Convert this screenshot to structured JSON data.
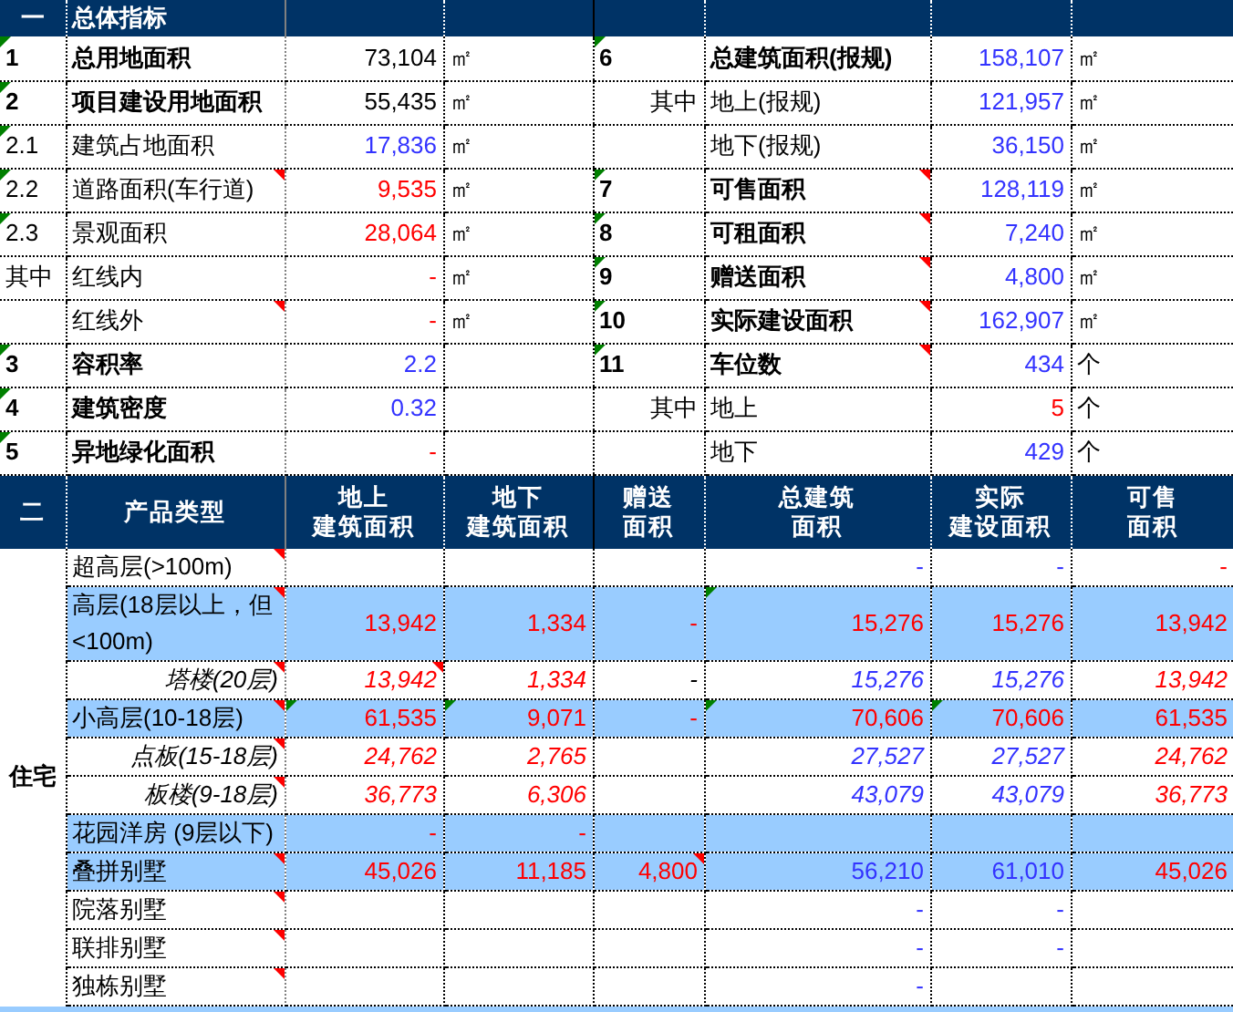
{
  "summary": {
    "section_no": "一",
    "title": "总体指标",
    "rows": [
      {
        "left": {
          "no": "1",
          "flagged": true,
          "label": "总用地面积",
          "bold": true,
          "value": "73,104",
          "color": "#000000",
          "unit": "㎡"
        },
        "right": {
          "no": "6",
          "flagged": true,
          "label": "总建筑面积(报规)",
          "bold": true,
          "value": "158,107",
          "color": "#3333ff",
          "unit": "㎡"
        }
      },
      {
        "left": {
          "no": "2",
          "flagged": true,
          "label": "项目建设用地面积",
          "bold": true,
          "value": "55,435",
          "color": "#000000",
          "unit": "㎡"
        },
        "right": {
          "no": "其中",
          "label": "地上(报规)",
          "value": "121,957",
          "color": "#3333ff",
          "unit": "㎡"
        }
      },
      {
        "left": {
          "no": "2.1",
          "flagged": true,
          "label": "建筑占地面积",
          "value": "17,836",
          "color": "#3333ff",
          "unit": "㎡"
        },
        "right": {
          "label": "地下(报规)",
          "value": "36,150",
          "color": "#3333ff",
          "unit": "㎡"
        }
      },
      {
        "left": {
          "no": "2.2",
          "flagged": true,
          "label": "道路面积(车行道)",
          "comment": true,
          "value": "9,535",
          "color": "#ff0000",
          "unit": "㎡"
        },
        "right": {
          "no": "7",
          "flagged": true,
          "label": "可售面积",
          "bold": true,
          "comment": true,
          "value": "128,119",
          "color": "#3333ff",
          "unit": "㎡"
        }
      },
      {
        "left": {
          "no": "2.3",
          "flagged": true,
          "label": "景观面积",
          "value": "28,064",
          "color": "#ff0000",
          "unit": "㎡"
        },
        "right": {
          "no": "8",
          "flagged": true,
          "label": "可租面积",
          "bold": true,
          "comment": true,
          "value": "7,240",
          "color": "#3333ff",
          "unit": "㎡"
        }
      },
      {
        "left": {
          "no": "其中",
          "label": "红线内",
          "value": "-",
          "color": "#ff0000",
          "unit": "㎡"
        },
        "right": {
          "no": "9",
          "flagged": true,
          "label": "赠送面积",
          "bold": true,
          "comment": true,
          "value": "4,800",
          "color": "#3333ff",
          "unit": "㎡"
        }
      },
      {
        "left": {
          "label": "红线外",
          "comment": true,
          "value": "-",
          "color": "#ff0000",
          "unit": "㎡"
        },
        "right": {
          "no": "10",
          "flagged": true,
          "label": "实际建设面积",
          "bold": true,
          "comment": true,
          "value": "162,907",
          "color": "#3333ff",
          "unit": "㎡"
        }
      },
      {
        "left": {
          "no": "3",
          "flagged": true,
          "label": "容积率",
          "bold": true,
          "value": "2.2",
          "color": "#3333ff"
        },
        "right": {
          "no": "11",
          "flagged": true,
          "label": "车位数",
          "bold": true,
          "comment": true,
          "value": "434",
          "color": "#3333ff",
          "unit": "个"
        }
      },
      {
        "left": {
          "no": "4",
          "flagged": true,
          "label": "建筑密度",
          "bold": true,
          "value": "0.32",
          "color": "#3333ff"
        },
        "right": {
          "no": "其中",
          "label": "地上",
          "value": "5",
          "color": "#ff0000",
          "unit": "个"
        }
      },
      {
        "left": {
          "no": "5",
          "flagged": true,
          "label": "异地绿化面积",
          "bold": true,
          "value": "-",
          "color": "#ff0000"
        },
        "right": {
          "label": "地下",
          "value": "429",
          "color": "#3333ff",
          "unit": "个"
        }
      }
    ]
  },
  "products": {
    "header": [
      {
        "lines": [
          "二"
        ]
      },
      {
        "lines": [
          "产品类型"
        ]
      },
      {
        "lines": [
          "地上",
          "建筑面积"
        ]
      },
      {
        "lines": [
          "地下",
          "建筑面积"
        ]
      },
      {
        "lines": [
          "赠送",
          "面积"
        ]
      },
      {
        "lines": [
          "总建筑",
          "面积"
        ]
      },
      {
        "lines": [
          "实际",
          "建设面积"
        ]
      },
      {
        "lines": [
          "可售",
          "面积"
        ]
      }
    ],
    "group": "住宅",
    "rows": [
      {
        "kind": "main",
        "label": "超高层(>100m)",
        "comment": true,
        "highlighted": false,
        "cells": [
          {},
          {},
          {},
          {
            "text": "-",
            "color": "#3333ff"
          },
          {
            "text": "-",
            "color": "#3333ff"
          },
          {
            "text": "-",
            "color": "#ff0000"
          }
        ]
      },
      {
        "kind": "main",
        "label": "高层(18层以上，但<100m)",
        "comment": true,
        "highlighted": true,
        "cells": [
          {
            "text": "13,942",
            "color": "#ff0000"
          },
          {
            "text": "1,334",
            "color": "#ff0000"
          },
          {
            "text": "-",
            "color": "#ff0000"
          },
          {
            "text": "15,276",
            "color": "#ff0000",
            "flagged": true
          },
          {
            "text": "15,276",
            "color": "#ff0000"
          },
          {
            "text": "13,942",
            "color": "#ff0000"
          }
        ]
      },
      {
        "kind": "sub",
        "label": "塔楼(20层)",
        "comment": true,
        "highlighted": false,
        "cells": [
          {
            "text": "13,942",
            "color": "#ff0000",
            "comment": true
          },
          {
            "text": "1,334",
            "color": "#ff0000"
          },
          {
            "text": "-",
            "color": "#000000"
          },
          {
            "text": "15,276",
            "color": "#3333ff"
          },
          {
            "text": "15,276",
            "color": "#3333ff"
          },
          {
            "text": "13,942",
            "color": "#ff0000"
          }
        ]
      },
      {
        "kind": "main",
        "label": "小高层(10-18层)",
        "comment": true,
        "highlighted": true,
        "cells": [
          {
            "text": "61,535",
            "color": "#ff0000",
            "flagged": true
          },
          {
            "text": "9,071",
            "color": "#ff0000",
            "flagged": true
          },
          {
            "text": "-",
            "color": "#ff0000"
          },
          {
            "text": "70,606",
            "color": "#ff0000",
            "flagged": true
          },
          {
            "text": "70,606",
            "color": "#ff0000",
            "flagged": true
          },
          {
            "text": "61,535",
            "color": "#ff0000"
          }
        ]
      },
      {
        "kind": "sub",
        "label": "点板(15-18层)",
        "comment": true,
        "highlighted": false,
        "cells": [
          {
            "text": "24,762",
            "color": "#ff0000"
          },
          {
            "text": "2,765",
            "color": "#ff0000"
          },
          {},
          {
            "text": "27,527",
            "color": "#3333ff"
          },
          {
            "text": "27,527",
            "color": "#3333ff"
          },
          {
            "text": "24,762",
            "color": "#ff0000"
          }
        ]
      },
      {
        "kind": "sub",
        "label": "板楼(9-18层)",
        "comment": true,
        "highlighted": false,
        "cells": [
          {
            "text": "36,773",
            "color": "#ff0000"
          },
          {
            "text": "6,306",
            "color": "#ff0000"
          },
          {},
          {
            "text": "43,079",
            "color": "#3333ff"
          },
          {
            "text": "43,079",
            "color": "#3333ff"
          },
          {
            "text": "36,773",
            "color": "#ff0000"
          }
        ]
      },
      {
        "kind": "main",
        "label": "花园洋房 (9层以下)",
        "highlighted": true,
        "cells": [
          {
            "text": "-",
            "color": "#ff0000"
          },
          {
            "text": "-",
            "color": "#ff0000"
          },
          {},
          {},
          {},
          {}
        ]
      },
      {
        "kind": "main",
        "label": "叠拼别墅",
        "comment": true,
        "highlighted": true,
        "cells": [
          {
            "text": "45,026",
            "color": "#ff0000"
          },
          {
            "text": "11,185",
            "color": "#ff0000"
          },
          {
            "text": "4,800",
            "color": "#ff0000",
            "comment": true
          },
          {
            "text": "56,210",
            "color": "#3333ff"
          },
          {
            "text": "61,010",
            "color": "#3333ff"
          },
          {
            "text": "45,026",
            "color": "#ff0000"
          }
        ]
      },
      {
        "kind": "main",
        "label": "院落别墅",
        "comment": true,
        "highlighted": false,
        "cells": [
          {},
          {},
          {},
          {
            "text": "-",
            "color": "#3333ff"
          },
          {
            "text": "-",
            "color": "#3333ff"
          },
          {}
        ]
      },
      {
        "kind": "main",
        "label": "联排别墅",
        "comment": true,
        "highlighted": false,
        "cells": [
          {},
          {},
          {},
          {
            "text": "-",
            "color": "#3333ff"
          },
          {
            "text": "-",
            "color": "#3333ff"
          },
          {}
        ]
      },
      {
        "kind": "main",
        "label": "独栋别墅",
        "comment": true,
        "highlighted": false,
        "cells": [
          {},
          {},
          {},
          {
            "text": "-",
            "color": "#3333ff"
          },
          {},
          {}
        ]
      }
    ]
  }
}
